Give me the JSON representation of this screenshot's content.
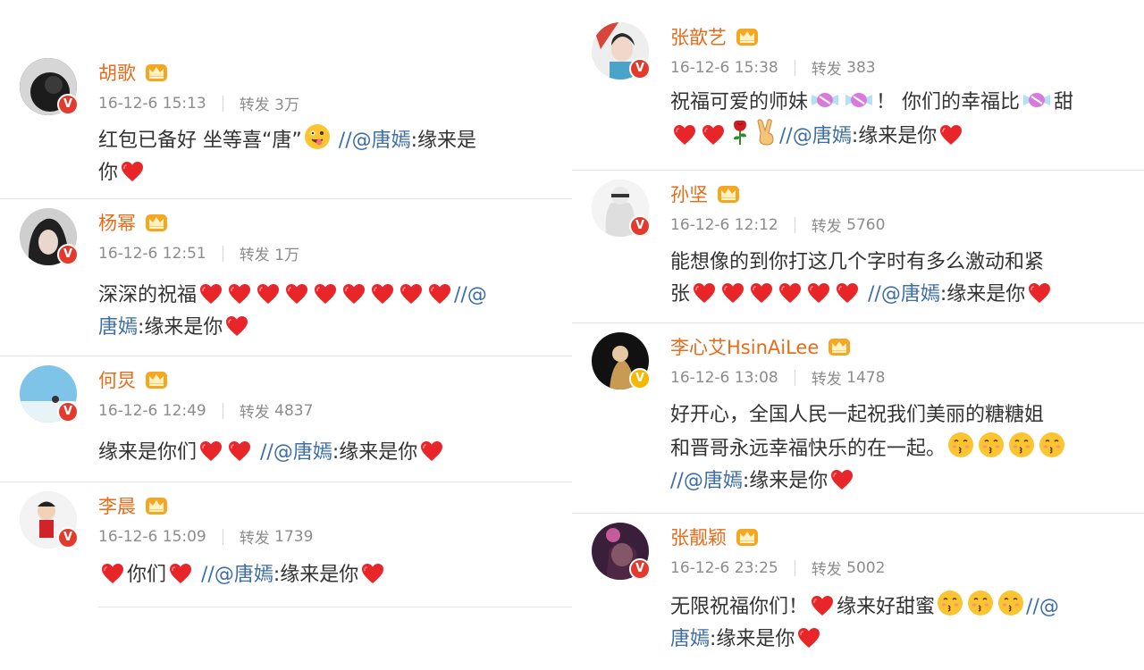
{
  "left": [
    {
      "name": "胡歌",
      "date": "16-12-6 15:13",
      "repost_label": "转发",
      "repost_count": "3万",
      "text_a": "红包已备好 坐等喜“唐”",
      "slashes": "//",
      "mention": "@唐嫣",
      "tail": ":缘来是",
      "tail2": "你",
      "badge": "red"
    },
    {
      "name": "杨幂",
      "date": "16-12-6 12:51",
      "repost_label": "转发",
      "repost_count": "1万",
      "text_a": "深深的祝福",
      "slashes": "//",
      "mention_a": "@",
      "mention_b": "唐嫣",
      "tail": ":缘来是你",
      "badge": "red"
    },
    {
      "name": "何炅",
      "date": "16-12-6 12:49",
      "repost_label": "转发",
      "repost_count": "4837",
      "text_a": "缘来是你们",
      "slashes": "//",
      "mention": "@唐嫣",
      "tail": ":缘来是你",
      "badge": "red"
    },
    {
      "name": "李晨",
      "date": "16-12-6 15:09",
      "repost_label": "转发",
      "repost_count": "1739",
      "text_a": "你们",
      "slashes": "//",
      "mention": "@唐嫣",
      "tail": ":缘来是你",
      "badge": "red"
    }
  ],
  "right": [
    {
      "name": "张歆艺",
      "date": "16-12-6 15:38",
      "repost_label": "转发",
      "repost_count": "383",
      "text_a": "祝福可爱的师妹",
      "text_b": "！ 你们的幸福比",
      "text_c": "甜",
      "slashes": "//",
      "mention": "@唐嫣",
      "tail": ":缘来是你",
      "badge": "red"
    },
    {
      "name": "孙坚",
      "date": "16-12-6 12:12",
      "repost_label": "转发",
      "repost_count": "5760",
      "text_a": "能想像的到你打这几个字时有多么激动和紧",
      "text_b": "张",
      "slashes": "//",
      "mention": "@唐嫣",
      "tail": ":缘来是你",
      "badge": "red"
    },
    {
      "name": "李心艾HsinAiLee",
      "date": "16-12-6 13:08",
      "repost_label": "转发",
      "repost_count": "1478",
      "text_a": "好开心，全国人民一起祝我们美丽的糖糖姐",
      "text_b": "和晋哥永远幸福快乐的在一起。",
      "slashes": "//",
      "mention": "@唐嫣",
      "tail": ":缘来是你",
      "badge": "gold"
    },
    {
      "name": "张靓颖",
      "date": "16-12-6 23:25",
      "repost_label": "转发",
      "repost_count": "5002",
      "text_a": "无限祝福你们！",
      "text_b": "缘来好甜蜜",
      "slashes": "//",
      "mention_a": "@",
      "mention_b": "唐嫣",
      "tail": ":缘来是你",
      "badge": "red"
    }
  ],
  "icons": {
    "heart_color": "#e8262a",
    "crown_color": "#f5a623",
    "name_color": "#e86b1a",
    "link_color": "#3d6ea7"
  }
}
